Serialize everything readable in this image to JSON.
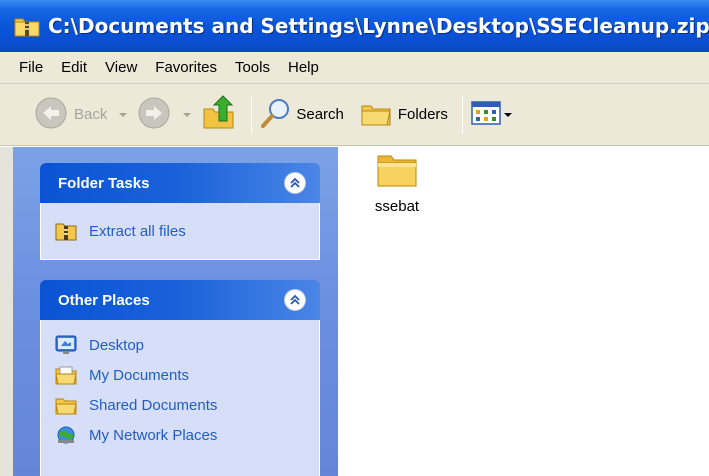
{
  "window": {
    "title": "C:\\Documents and Settings\\Lynne\\Desktop\\SSECleanup.zip"
  },
  "menu": {
    "items": [
      "File",
      "Edit",
      "View",
      "Favorites",
      "Tools",
      "Help"
    ]
  },
  "toolbar": {
    "back_label": "Back",
    "search_label": "Search",
    "folders_label": "Folders"
  },
  "folder_tasks": {
    "title": "Folder Tasks",
    "items": [
      {
        "label": "Extract all files",
        "icon": "extract-icon"
      }
    ]
  },
  "other_places": {
    "title": "Other Places",
    "items": [
      {
        "label": "Desktop",
        "icon": "desktop-icon"
      },
      {
        "label": "My Documents",
        "icon": "my-documents-icon"
      },
      {
        "label": "Shared Documents",
        "icon": "shared-folder-icon"
      },
      {
        "label": "My Network Places",
        "icon": "network-places-icon"
      }
    ]
  },
  "content": {
    "items": [
      {
        "label": "ssebat",
        "icon": "folder-icon"
      }
    ]
  },
  "colors": {
    "titlebar": "#0a55d8",
    "task_link": "#215dc6",
    "panel_body": "#d6dff7",
    "pane_bg": "#6b8fe0"
  }
}
